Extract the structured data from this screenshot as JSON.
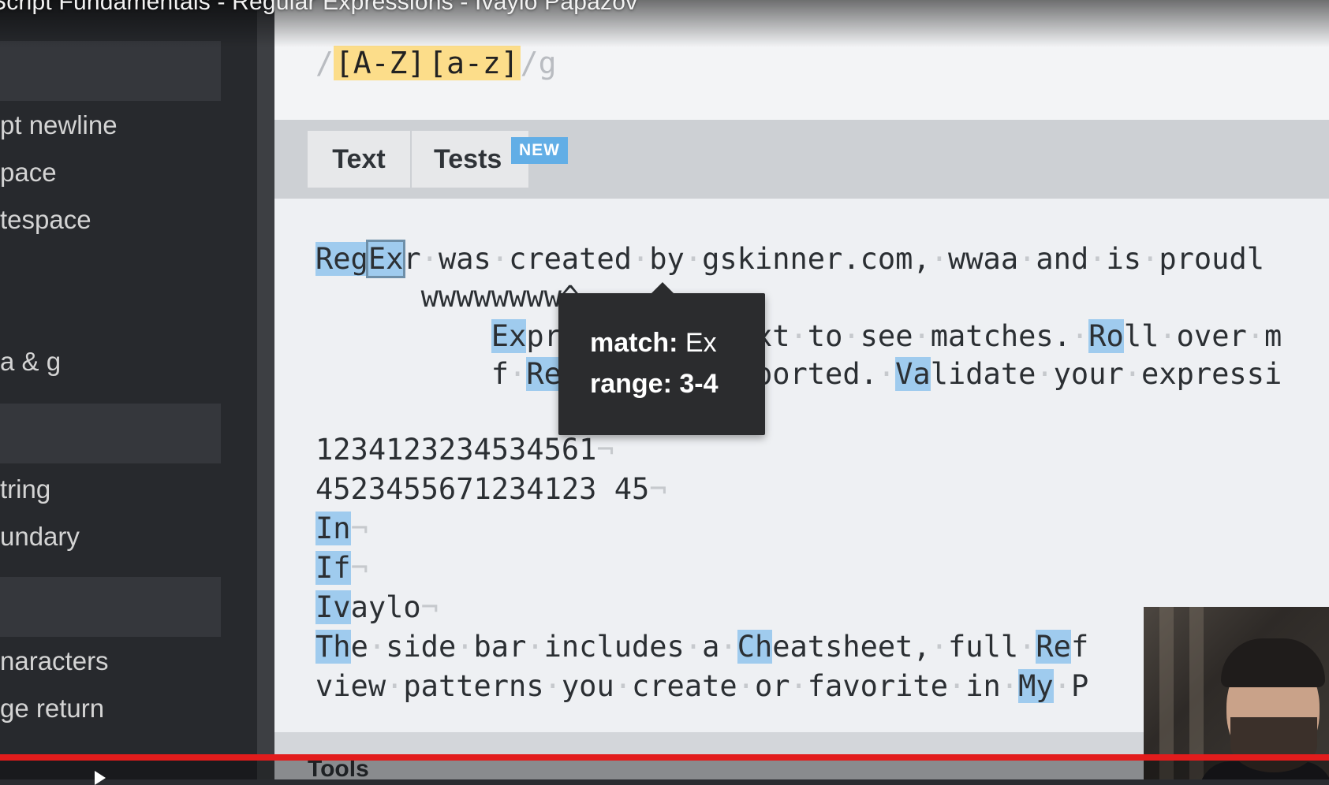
{
  "video": {
    "title": "Script Fundamentals - Regular Expressions - Ivaylo Papazov",
    "progress_percent": 100
  },
  "sidebar": {
    "items": [
      "pt newline",
      "pace",
      "tespace",
      "a & g",
      "tring",
      "undary",
      "naracters",
      "ge return"
    ]
  },
  "regex": {
    "open_delim": "/",
    "class1": "[A-Z]",
    "class2": "[a-z]",
    "close_delim": "/",
    "flags": "g"
  },
  "tabs": {
    "text": "Text",
    "tests": "Tests",
    "badge": "NEW"
  },
  "tooltip": {
    "match_label": "match:",
    "match_value": "Ex",
    "range_label": "range:",
    "range_value": "3-4"
  },
  "text_lines": {
    "numbers1": "1234123234534561",
    "numbers2": "4523455671234123 45",
    "in": "In",
    "if": "If",
    "ivaylo": "Ivaylo"
  },
  "tools": {
    "label": "Tools"
  },
  "colors": {
    "match_highlight": "#9fcbee",
    "char_class": "#fcdd8a",
    "progress": "#e21c1c",
    "badge": "#62aee6"
  }
}
